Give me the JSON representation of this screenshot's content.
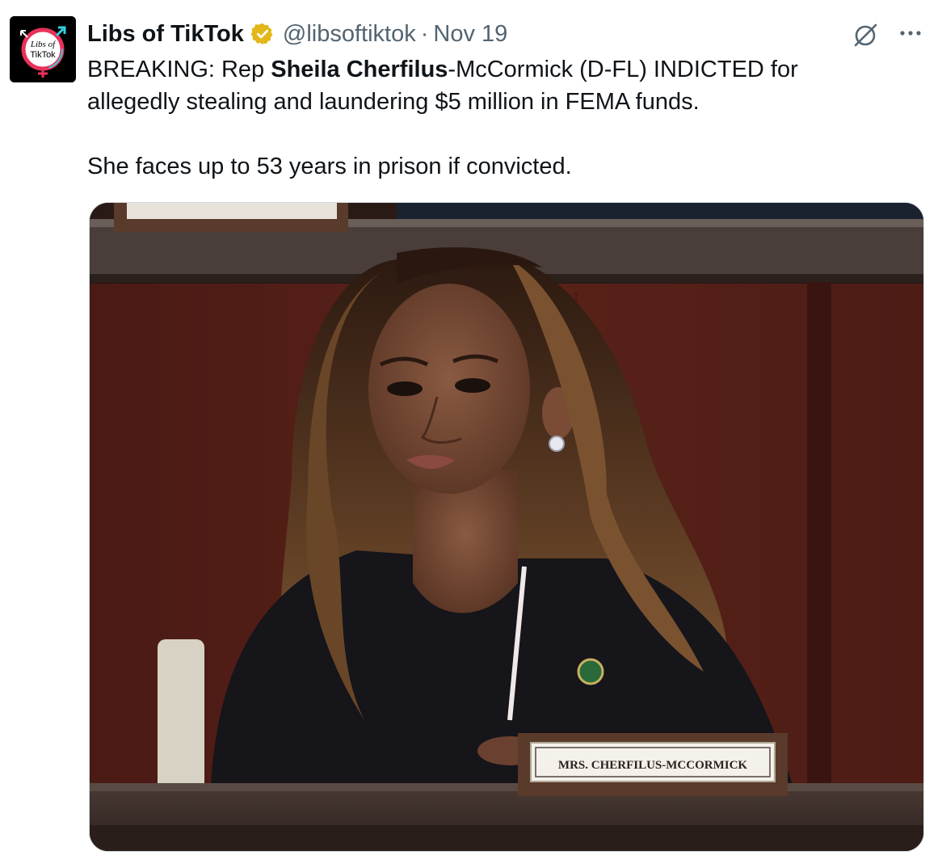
{
  "tweet": {
    "author": {
      "display_name": "Libs of TikTok",
      "handle": "@libsoftiktok",
      "verified": true,
      "verified_color": "#e2b719",
      "avatar_text_line1": "Libs of",
      "avatar_text_line2": "TikTok"
    },
    "separator": "·",
    "date": "Nov 19",
    "text": {
      "line1_prefix": "BREAKING: Rep ",
      "line1_bold": "Sheila Cherfilus",
      "line1_suffix": "-McCormick (D-FL) INDICTED for",
      "line2": "allegedly stealing and laundering $5 million in FEMA funds.",
      "line3": "She faces up to 53 years in prison if convicted."
    },
    "media": {
      "nameplate_text": "MRS. CHERFILUS-MCCORMICK"
    },
    "icons": {
      "grok": "grok-icon",
      "more": "more-icon",
      "verified": "verified-badge-icon"
    },
    "colors": {
      "text": "#0f1419",
      "secondary": "#536471",
      "border": "#cfd9de"
    }
  }
}
